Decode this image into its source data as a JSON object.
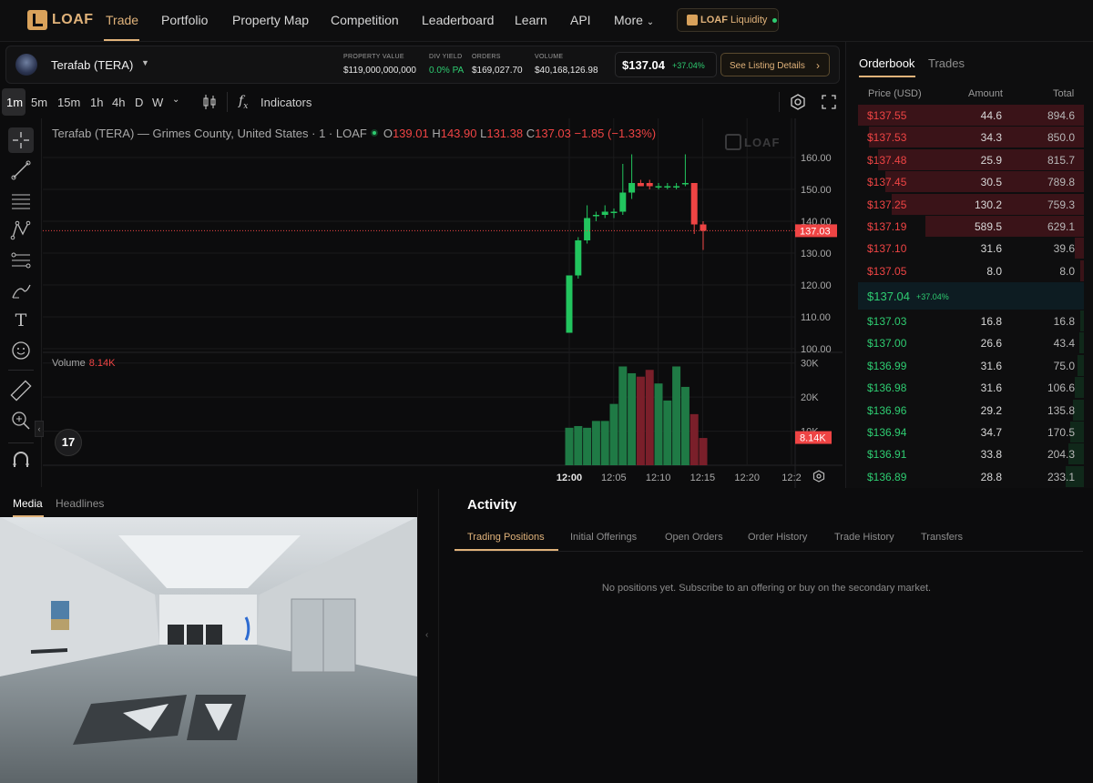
{
  "brand": {
    "name": "LOAF"
  },
  "nav": {
    "items": [
      "Trade",
      "Portfolio",
      "Property Map",
      "Competition",
      "Leaderboard",
      "Learn",
      "API",
      "More"
    ],
    "liquidity": {
      "brand": "LOAF",
      "label": "Liquidity",
      "status_color": "#2ecc71"
    }
  },
  "ticker": {
    "name": "Terafab (TERA)",
    "stats": [
      {
        "label": "PROPERTY VALUE",
        "value": "$119,000,000,000"
      },
      {
        "label": "DIV YIELD",
        "value": "0.0% PA"
      },
      {
        "label": "ORDERS",
        "value": "$169,027.70"
      },
      {
        "label": "VOLUME",
        "value": "$40,168,126.98"
      }
    ],
    "price": "$137.04",
    "change": "+37.04%",
    "listing_button": "See Listing Details"
  },
  "toolbar": {
    "timeframes": [
      "1m",
      "5m",
      "15m",
      "1h",
      "4h",
      "D",
      "W"
    ],
    "active_timeframe": "1m",
    "indicators_label": "Indicators"
  },
  "left_tools": [
    "crosshair-icon",
    "trendline-icon",
    "horizontal-lines-icon",
    "pattern-icon",
    "fib-icon",
    "brush-icon",
    "text-icon",
    "emoji-icon",
    "ruler-icon",
    "zoom-in-icon",
    "magnet-icon"
  ],
  "chart": {
    "title": "Terafab (TERA) — Grimes County, United States · 1 · LOAF",
    "ohlc": {
      "o": "139.01",
      "h": "143.90",
      "l": "131.38",
      "c": "137.03",
      "chg": "−1.85 (−1.33%)"
    },
    "watermark": "LOAF",
    "last_price_label": "137.03",
    "volume_title": "Volume",
    "volume_value": "8.14K",
    "volume_axis_label": "8.14K",
    "tv_badge": "17",
    "colors": {
      "up": "#22c55e",
      "down": "#ef4444",
      "vol_up": "#1f7a45",
      "vol_down": "#7a1f2a"
    }
  },
  "chart_data": {
    "type": "candlestick",
    "x_ticks": [
      "12:00",
      "12:05",
      "12:10",
      "12:15",
      "12:20",
      "12:2"
    ],
    "y_ticks": [
      160,
      150,
      140,
      130,
      120,
      110,
      100
    ],
    "y_tick_labels": [
      "160.00",
      "150.00",
      "140.00",
      "130.00",
      "120.00",
      "110.00",
      "100.00"
    ],
    "ylim": [
      100,
      166
    ],
    "volume_ticks": [
      "30K",
      "20K",
      "10K"
    ],
    "volume_ylim": [
      0,
      31
    ],
    "candles": [
      {
        "o": 105,
        "h": 123,
        "l": 105,
        "c": 123
      },
      {
        "o": 123,
        "h": 135,
        "l": 122,
        "c": 134
      },
      {
        "o": 134,
        "h": 145,
        "l": 133,
        "c": 141
      },
      {
        "o": 142,
        "h": 143,
        "l": 140,
        "c": 142
      },
      {
        "o": 142,
        "h": 145,
        "l": 141,
        "c": 143
      },
      {
        "o": 143,
        "h": 144,
        "l": 141,
        "c": 143
      },
      {
        "o": 143,
        "h": 158,
        "l": 142,
        "c": 149
      },
      {
        "o": 149,
        "h": 161,
        "l": 147,
        "c": 152
      },
      {
        "o": 152,
        "h": 153,
        "l": 151,
        "c": 151
      },
      {
        "o": 152,
        "h": 153,
        "l": 150,
        "c": 151
      },
      {
        "o": 151,
        "h": 152,
        "l": 150,
        "c": 151
      },
      {
        "o": 151,
        "h": 152,
        "l": 150,
        "c": 151
      },
      {
        "o": 151,
        "h": 152,
        "l": 150,
        "c": 151
      },
      {
        "o": 152,
        "h": 161,
        "l": 151,
        "c": 152
      },
      {
        "o": 152,
        "h": 152,
        "l": 136,
        "c": 139
      },
      {
        "o": 139,
        "h": 140,
        "l": 131,
        "c": 137
      }
    ],
    "volumes": [
      11,
      11.5,
      11,
      13,
      13,
      18,
      29,
      27,
      26,
      28,
      24,
      19,
      29,
      23,
      15,
      8
    ],
    "last_price": 137.03
  },
  "orderbook": {
    "tabs": [
      "Orderbook",
      "Trades"
    ],
    "headers": [
      "Price (USD)",
      "Amount",
      "Total"
    ],
    "asks": [
      {
        "price": "$137.55",
        "amount": "44.6",
        "total": "894.6",
        "depth": 1.0
      },
      {
        "price": "$137.53",
        "amount": "34.3",
        "total": "850.0",
        "depth": 0.95
      },
      {
        "price": "$137.48",
        "amount": "25.9",
        "total": "815.7",
        "depth": 0.91
      },
      {
        "price": "$137.45",
        "amount": "30.5",
        "total": "789.8",
        "depth": 0.88
      },
      {
        "price": "$137.25",
        "amount": "130.2",
        "total": "759.3",
        "depth": 0.85
      },
      {
        "price": "$137.19",
        "amount": "589.5",
        "total": "629.1",
        "depth": 0.7
      },
      {
        "price": "$137.10",
        "amount": "31.6",
        "total": "39.6",
        "depth": 0.04
      },
      {
        "price": "$137.05",
        "amount": "8.0",
        "total": "8.0",
        "depth": 0.01
      }
    ],
    "mid": {
      "price": "$137.04",
      "change": "+37.04%"
    },
    "bids": [
      {
        "price": "$137.03",
        "amount": "16.8",
        "total": "16.8",
        "depth": 0.01
      },
      {
        "price": "$137.00",
        "amount": "26.6",
        "total": "43.4",
        "depth": 0.02
      },
      {
        "price": "$136.99",
        "amount": "31.6",
        "total": "75.0",
        "depth": 0.03
      },
      {
        "price": "$136.98",
        "amount": "31.6",
        "total": "106.6",
        "depth": 0.04
      },
      {
        "price": "$136.96",
        "amount": "29.2",
        "total": "135.8",
        "depth": 0.05
      },
      {
        "price": "$136.94",
        "amount": "34.7",
        "total": "170.5",
        "depth": 0.06
      },
      {
        "price": "$136.91",
        "amount": "33.8",
        "total": "204.3",
        "depth": 0.07
      },
      {
        "price": "$136.89",
        "amount": "28.8",
        "total": "233.1",
        "depth": 0.08
      }
    ]
  },
  "media": {
    "tabs": [
      "Media",
      "Headlines"
    ]
  },
  "activity": {
    "title": "Activity",
    "tabs": [
      "Trading Positions",
      "Initial Offerings",
      "Open Orders",
      "Order History",
      "Trade History",
      "Transfers"
    ],
    "empty_message": "No positions yet. Subscribe to an offering or buy on the secondary market."
  }
}
